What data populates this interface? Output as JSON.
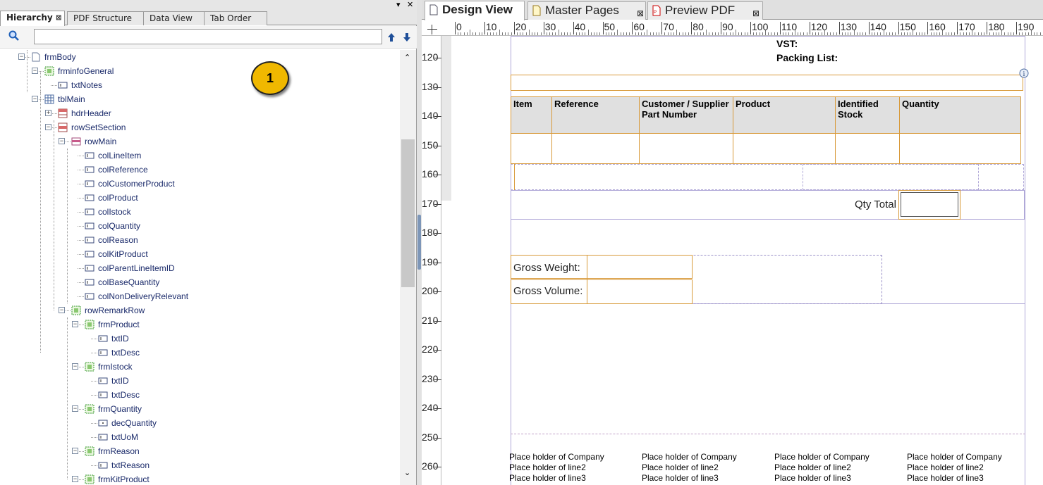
{
  "left_panel": {
    "tabs": [
      {
        "label": "Hierarchy",
        "active": true
      },
      {
        "label": "PDF Structure"
      },
      {
        "label": "Data View"
      },
      {
        "label": "Tab Order"
      }
    ]
  },
  "tree": [
    {
      "label": "frmBody",
      "icon": "page-icon",
      "expanded": true
    },
    {
      "label": "frminfoGeneral",
      "icon": "subform-icon",
      "expanded": true
    },
    {
      "label": "txtNotes",
      "icon": "textfield-icon"
    },
    {
      "label": "tblMain",
      "icon": "table-icon",
      "expanded": true
    },
    {
      "label": "hdrHeader",
      "icon": "table-header-icon",
      "expanded": false
    },
    {
      "label": "rowSetSection",
      "icon": "rowset-icon",
      "expanded": true
    },
    {
      "label": "rowMain",
      "icon": "row-icon",
      "expanded": true
    },
    {
      "label": "colLineItem",
      "icon": "textfield-icon"
    },
    {
      "label": "colReference",
      "icon": "textfield-icon"
    },
    {
      "label": "colCustomerProduct",
      "icon": "textfield-icon"
    },
    {
      "label": "colProduct",
      "icon": "textfield-icon"
    },
    {
      "label": "colIstock",
      "icon": "textfield-icon"
    },
    {
      "label": "colQuantity",
      "icon": "textfield-icon"
    },
    {
      "label": "colReason",
      "icon": "textfield-icon"
    },
    {
      "label": "colKitProduct",
      "icon": "textfield-icon"
    },
    {
      "label": "colParentLineItemID",
      "icon": "textfield-icon"
    },
    {
      "label": "colBaseQuantity",
      "icon": "textfield-icon"
    },
    {
      "label": "colNonDeliveryRelevant",
      "icon": "textfield-icon"
    },
    {
      "label": "rowRemarkRow",
      "icon": "subform-icon",
      "expanded": true
    },
    {
      "label": "frmProduct",
      "icon": "subform-icon",
      "expanded": true
    },
    {
      "label": "txtID",
      "icon": "textfield-icon"
    },
    {
      "label": "txtDesc",
      "icon": "textfield-icon"
    },
    {
      "label": "frmIstock",
      "icon": "subform-icon",
      "expanded": true
    },
    {
      "label": "txtID",
      "icon": "textfield-icon"
    },
    {
      "label": "txtDesc",
      "icon": "textfield-icon"
    },
    {
      "label": "frmQuantity",
      "icon": "subform-icon",
      "expanded": true
    },
    {
      "label": "decQuantity",
      "icon": "decimal-field-icon"
    },
    {
      "label": "txtUoM",
      "icon": "textfield-icon"
    },
    {
      "label": "frmReason",
      "icon": "subform-icon",
      "expanded": true
    },
    {
      "label": "txtReason",
      "icon": "textfield-icon"
    },
    {
      "label": "frmKitProduct",
      "icon": "subform-icon",
      "expanded": true
    }
  ],
  "callout_badge": "1",
  "right_panel": {
    "tabs": [
      {
        "label": "Design View",
        "active": true,
        "icon": "page-icon"
      },
      {
        "label": "Master Pages",
        "icon": "master-page-icon"
      },
      {
        "label": "Preview PDF",
        "icon": "pdf-icon"
      }
    ]
  },
  "ruler_top": [
    "0",
    "10",
    "20",
    "30",
    "40",
    "50",
    "60",
    "70",
    "80",
    "90",
    "100",
    "110",
    "120",
    "130",
    "140",
    "150",
    "160",
    "170",
    "180",
    "190"
  ],
  "ruler_left": [
    "120",
    "130",
    "140",
    "150",
    "160",
    "170",
    "180",
    "190",
    "200",
    "210",
    "220",
    "230",
    "240",
    "250",
    "260"
  ],
  "form": {
    "vst_label": "VST:",
    "packing_list_label": "Packing List:",
    "table_headers": [
      "Item",
      "Reference",
      "Customer / Supplier Part Number",
      "Product",
      "Identified Stock",
      "Quantity"
    ],
    "qty_total_label": "Qty Total",
    "gross_weight_label": "Gross Weight:",
    "gross_volume_label": "Gross Volume:",
    "footer_columns": [
      [
        "Place holder of Company",
        "Place holder of line2",
        "Place holder of line3"
      ],
      [
        "Place holder of Company",
        "Place holder of line2",
        "Place holder of line3"
      ],
      [
        "Place holder of Company",
        "Place holder of line2",
        "Place holder of line3"
      ],
      [
        "Place holder of Company",
        "Place holder of line2",
        "Place holder of line3"
      ]
    ]
  }
}
